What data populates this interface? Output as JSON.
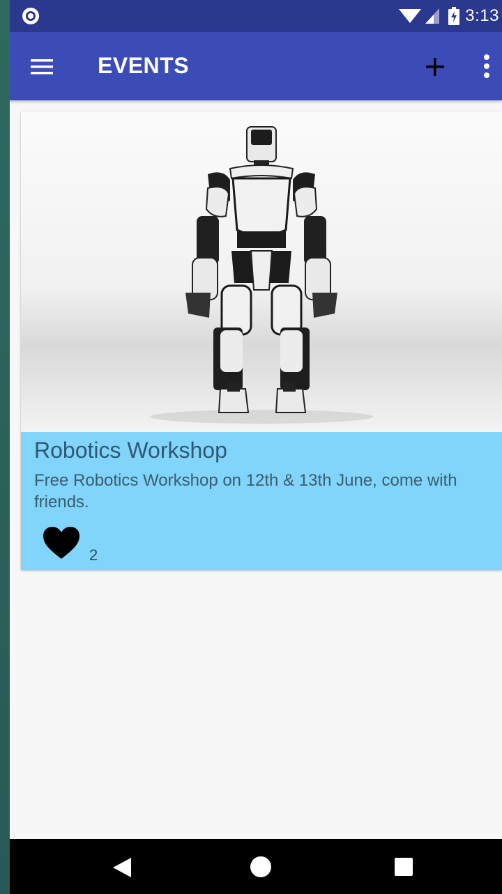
{
  "status_bar": {
    "time": "3:13",
    "icons": [
      "notification-circle-icon",
      "wifi-icon",
      "signal-icon",
      "battery-charging-icon"
    ]
  },
  "app_bar": {
    "title": "EVENTS",
    "icons": [
      "menu-icon",
      "add-icon",
      "more-vert-icon"
    ]
  },
  "event_card": {
    "image": "robot-photo",
    "title": "Robotics Workshop",
    "description": "Free Robotics Workshop on 12th & 13th June, come with friends.",
    "like_icon": "heart-icon",
    "likes": "2",
    "background_color": "#81d4fa"
  },
  "nav_bar": {
    "icons": [
      "back-icon",
      "home-icon",
      "recents-icon"
    ]
  },
  "colors": {
    "status_bar": "#2b3890",
    "app_bar": "#3b4cb8",
    "card": "#81d4fa",
    "page_background": "#f7f7f7"
  }
}
